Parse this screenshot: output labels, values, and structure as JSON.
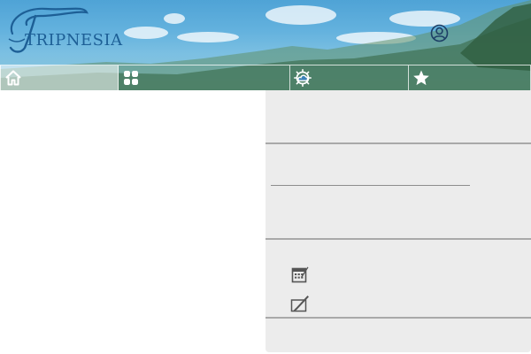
{
  "app": {
    "brand_name": "TRIPNESIA",
    "logo_name": "tripnesia-logo"
  },
  "header": {
    "account_icon": "user-circle-icon"
  },
  "nav": {
    "items": [
      {
        "id": "home",
        "icon": "home-icon",
        "active": true
      },
      {
        "id": "categories",
        "icon": "grid-icon",
        "active": false
      },
      {
        "id": "weather",
        "icon": "weather-icon",
        "active": false
      },
      {
        "id": "favorites",
        "icon": "star-icon",
        "active": false
      }
    ]
  },
  "panel": {
    "tools": [
      {
        "id": "calendar",
        "icon": "calendar-icon"
      },
      {
        "id": "edit",
        "icon": "edit-icon"
      }
    ]
  },
  "colors": {
    "brand": "#1d5f96",
    "panel_bg": "#ececec",
    "separator": "#a9a9a9"
  }
}
